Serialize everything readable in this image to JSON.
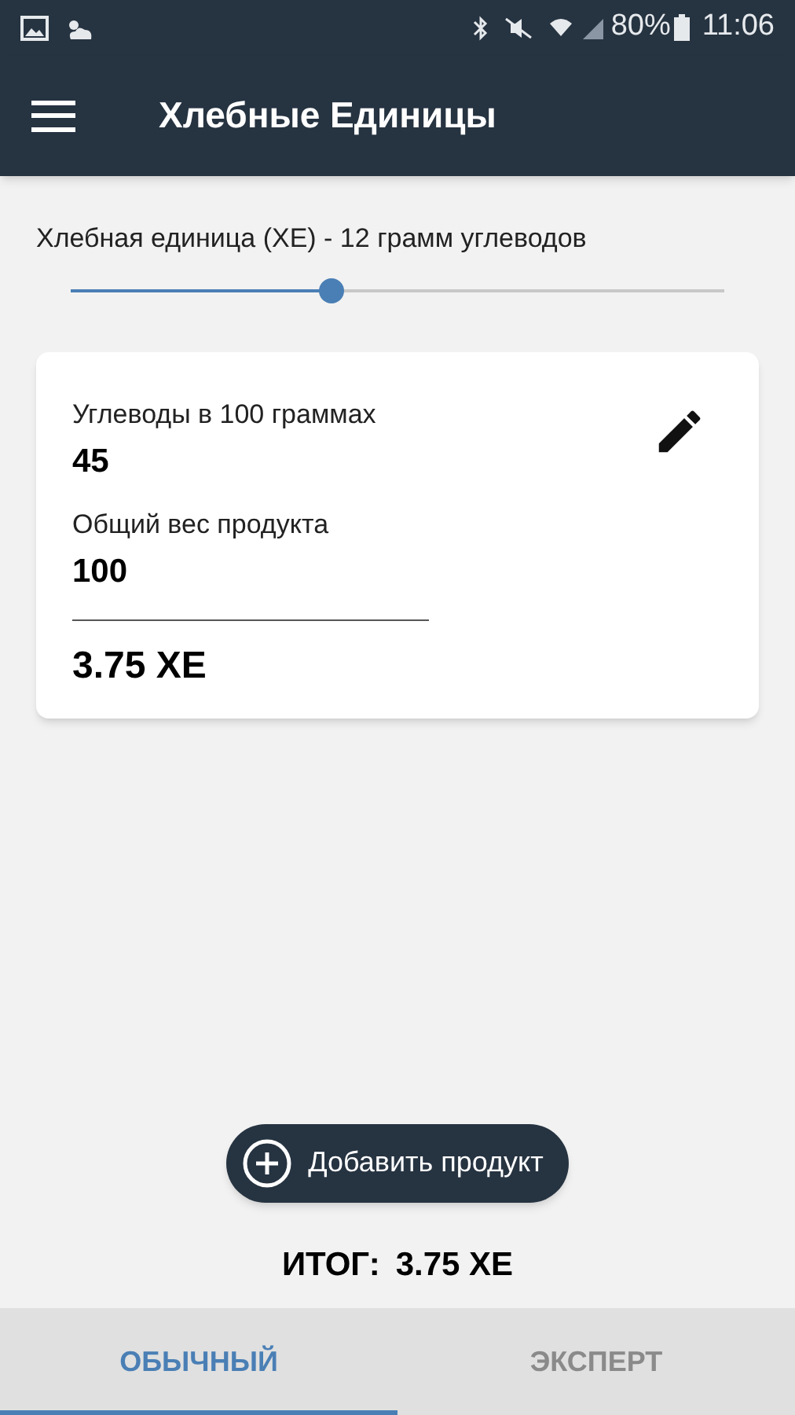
{
  "status_bar": {
    "battery": "80%",
    "time": "11:06"
  },
  "app_bar": {
    "title": "Хлебные Единицы"
  },
  "unit_setting": {
    "label": "Хлебная единица (ХЕ) - 12 грамм углеводов",
    "level": 0.4
  },
  "product_card": {
    "carbs_label": "Углеводы в 100 граммах",
    "carbs_value": "45",
    "weight_label": "Общий вес продукта",
    "weight_value": "100",
    "result": "3.75 ХЕ"
  },
  "add_button": {
    "label": "Добавить продукт"
  },
  "total": {
    "label": "ИТОГ:",
    "value": "3.75 ХЕ"
  },
  "tabs": [
    {
      "label": "ОБЫЧНЫЙ",
      "selected": true
    },
    {
      "label": "ЭКСПЕРТ",
      "selected": false
    }
  ]
}
